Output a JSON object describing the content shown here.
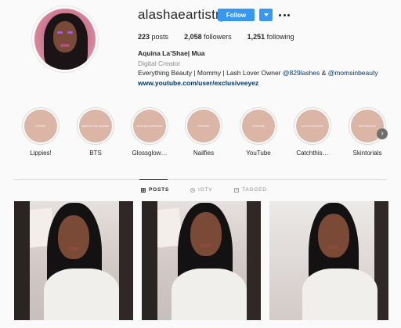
{
  "profile": {
    "username": "alashaeartistry",
    "follow_label": "Follow",
    "more_label": "…",
    "stats": {
      "posts_count": "223",
      "posts_label": "posts",
      "followers_count": "2,058",
      "followers_label": "followers",
      "following_count": "1,251",
      "following_label": "following"
    },
    "bio": {
      "full_name": "Aquina La’Shae| Mua",
      "category": "Digital Creator",
      "line_prefix": "Everything Beauty | Mommy | Lash Lover Owner ",
      "mention_1": "@829lashes",
      "line_mid": " & ",
      "mention_2": "@momsinbeauty",
      "url": "www.youtube.com/user/exclusiveeyez"
    }
  },
  "highlights": [
    {
      "label": "Lippies!",
      "cover_text": "LIPPIES"
    },
    {
      "label": "BTS",
      "cover_text": "BEHIND THE SCENES"
    },
    {
      "label": "Glossglow…",
      "cover_text": "GLOSSGLOWGLEAM"
    },
    {
      "label": "Nailfies",
      "cover_text": "NAILFIES"
    },
    {
      "label": "YouTube",
      "cover_text": "YOUTUBE"
    },
    {
      "label": "Catchthis…",
      "cover_text": "CATCHTHISHOOK"
    },
    {
      "label": "Skintorials",
      "cover_text": "SKINTORIALS"
    }
  ],
  "highlights_next": "›",
  "tabs": [
    {
      "label": "POSTS",
      "active": true
    },
    {
      "label": "IGTV",
      "active": false
    },
    {
      "label": "TAGGED",
      "active": false
    }
  ],
  "colors": {
    "accent": "#3897f0",
    "link": "#00376b",
    "highlight_cover": "#dbb6a7"
  },
  "icons": {
    "dropdown": "chevron-down-icon",
    "more": "more-horizontal-icon",
    "posts_tab": "grid-icon",
    "igtv_tab": "igtv-icon",
    "tagged_tab": "tagged-icon",
    "highlights_next": "chevron-right-icon"
  }
}
